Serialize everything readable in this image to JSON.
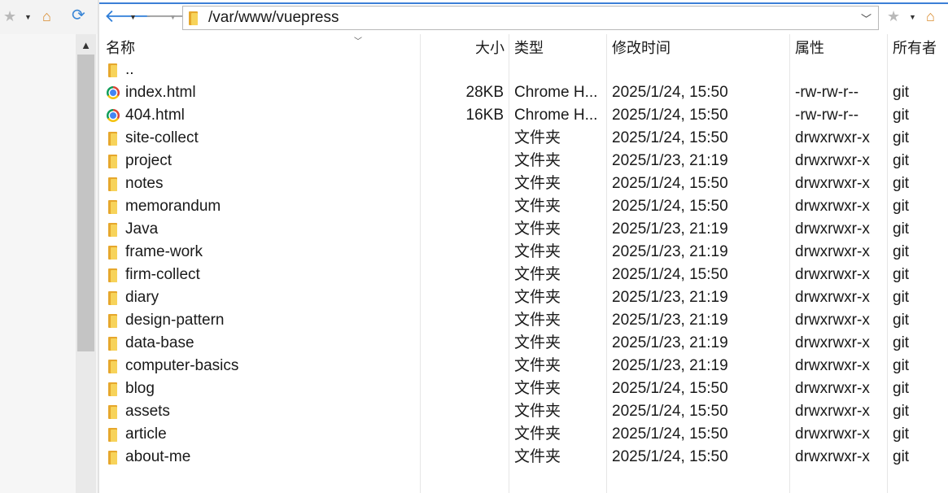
{
  "toolbar": {
    "path": "/var/www/vuepress"
  },
  "columns": {
    "name": "名称",
    "size": "大小",
    "type": "类型",
    "modified": "修改时间",
    "attributes": "属性",
    "owner": "所有者"
  },
  "files": [
    {
      "name": "..",
      "icon": "folder-icon",
      "size": "",
      "type": "",
      "modified": "",
      "attributes": "",
      "owner": ""
    },
    {
      "name": "index.html",
      "icon": "chrome-file-icon",
      "size": "28KB",
      "type": "Chrome H...",
      "modified": "2025/1/24, 15:50",
      "attributes": "-rw-rw-r--",
      "owner": "git"
    },
    {
      "name": "404.html",
      "icon": "chrome-file-icon",
      "size": "16KB",
      "type": "Chrome H...",
      "modified": "2025/1/24, 15:50",
      "attributes": "-rw-rw-r--",
      "owner": "git"
    },
    {
      "name": "site-collect",
      "icon": "folder-icon",
      "size": "",
      "type": "文件夹",
      "modified": "2025/1/24, 15:50",
      "attributes": "drwxrwxr-x",
      "owner": "git"
    },
    {
      "name": "project",
      "icon": "folder-icon",
      "size": "",
      "type": "文件夹",
      "modified": "2025/1/23, 21:19",
      "attributes": "drwxrwxr-x",
      "owner": "git"
    },
    {
      "name": "notes",
      "icon": "folder-icon",
      "size": "",
      "type": "文件夹",
      "modified": "2025/1/24, 15:50",
      "attributes": "drwxrwxr-x",
      "owner": "git"
    },
    {
      "name": "memorandum",
      "icon": "folder-icon",
      "size": "",
      "type": "文件夹",
      "modified": "2025/1/24, 15:50",
      "attributes": "drwxrwxr-x",
      "owner": "git"
    },
    {
      "name": "Java",
      "icon": "folder-icon",
      "size": "",
      "type": "文件夹",
      "modified": "2025/1/23, 21:19",
      "attributes": "drwxrwxr-x",
      "owner": "git"
    },
    {
      "name": "frame-work",
      "icon": "folder-icon",
      "size": "",
      "type": "文件夹",
      "modified": "2025/1/23, 21:19",
      "attributes": "drwxrwxr-x",
      "owner": "git"
    },
    {
      "name": "firm-collect",
      "icon": "folder-icon",
      "size": "",
      "type": "文件夹",
      "modified": "2025/1/24, 15:50",
      "attributes": "drwxrwxr-x",
      "owner": "git"
    },
    {
      "name": "diary",
      "icon": "folder-icon",
      "size": "",
      "type": "文件夹",
      "modified": "2025/1/23, 21:19",
      "attributes": "drwxrwxr-x",
      "owner": "git"
    },
    {
      "name": "design-pattern",
      "icon": "folder-icon",
      "size": "",
      "type": "文件夹",
      "modified": "2025/1/23, 21:19",
      "attributes": "drwxrwxr-x",
      "owner": "git"
    },
    {
      "name": "data-base",
      "icon": "folder-icon",
      "size": "",
      "type": "文件夹",
      "modified": "2025/1/23, 21:19",
      "attributes": "drwxrwxr-x",
      "owner": "git"
    },
    {
      "name": "computer-basics",
      "icon": "folder-icon",
      "size": "",
      "type": "文件夹",
      "modified": "2025/1/23, 21:19",
      "attributes": "drwxrwxr-x",
      "owner": "git"
    },
    {
      "name": "blog",
      "icon": "folder-icon",
      "size": "",
      "type": "文件夹",
      "modified": "2025/1/24, 15:50",
      "attributes": "drwxrwxr-x",
      "owner": "git"
    },
    {
      "name": "assets",
      "icon": "folder-icon",
      "size": "",
      "type": "文件夹",
      "modified": "2025/1/24, 15:50",
      "attributes": "drwxrwxr-x",
      "owner": "git"
    },
    {
      "name": "article",
      "icon": "folder-icon",
      "size": "",
      "type": "文件夹",
      "modified": "2025/1/24, 15:50",
      "attributes": "drwxrwxr-x",
      "owner": "git"
    },
    {
      "name": "about-me",
      "icon": "folder-icon",
      "size": "",
      "type": "文件夹",
      "modified": "2025/1/24, 15:50",
      "attributes": "drwxrwxr-x",
      "owner": "git"
    }
  ]
}
